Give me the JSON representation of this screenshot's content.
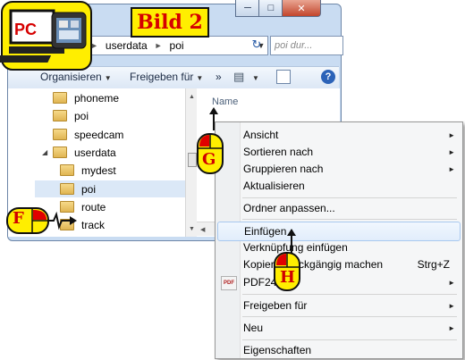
{
  "overlay": {
    "pc_logo_text": "PC",
    "image_label": "Bild 2",
    "markers": [
      "G",
      "H",
      "F"
    ]
  },
  "explorer": {
    "address": {
      "segments": [
        "userdata",
        "poi"
      ]
    },
    "search_placeholder": "poi dur...",
    "toolbar": {
      "organize": "Organisieren",
      "share": "Freigeben für",
      "more": "»",
      "help": "?"
    },
    "tree": [
      {
        "label": "phoneme"
      },
      {
        "label": "poi"
      },
      {
        "label": "speedcam"
      },
      {
        "label": "userdata",
        "expanded": true
      },
      {
        "label": "mydest"
      },
      {
        "label": "poi",
        "selected": true
      },
      {
        "label": "route"
      },
      {
        "label": "track"
      }
    ],
    "column_header": "Name"
  },
  "context_menu": {
    "items": [
      {
        "label": "Ansicht",
        "submenu": true
      },
      {
        "label": "Sortieren nach",
        "submenu": true
      },
      {
        "label": "Gruppieren nach",
        "submenu": true
      },
      {
        "label": "Aktualisieren"
      },
      {
        "label": "Ordner anpassen..."
      },
      {
        "label": "Einfügen",
        "highlighted": true
      },
      {
        "label": "Verknüpfung einfügen"
      },
      {
        "label": "Kopieren rückgängig machen",
        "shortcut": "Strg+Z"
      },
      {
        "label": "PDF24",
        "submenu": true
      },
      {
        "label": "Freigeben für",
        "submenu": true
      },
      {
        "label": "Neu",
        "submenu": true
      },
      {
        "label": "Eigenschaften"
      }
    ]
  },
  "colors": {
    "label_yellow": "#ffee00",
    "label_red": "#d60000",
    "menu_highlight": "#e1edfb"
  }
}
